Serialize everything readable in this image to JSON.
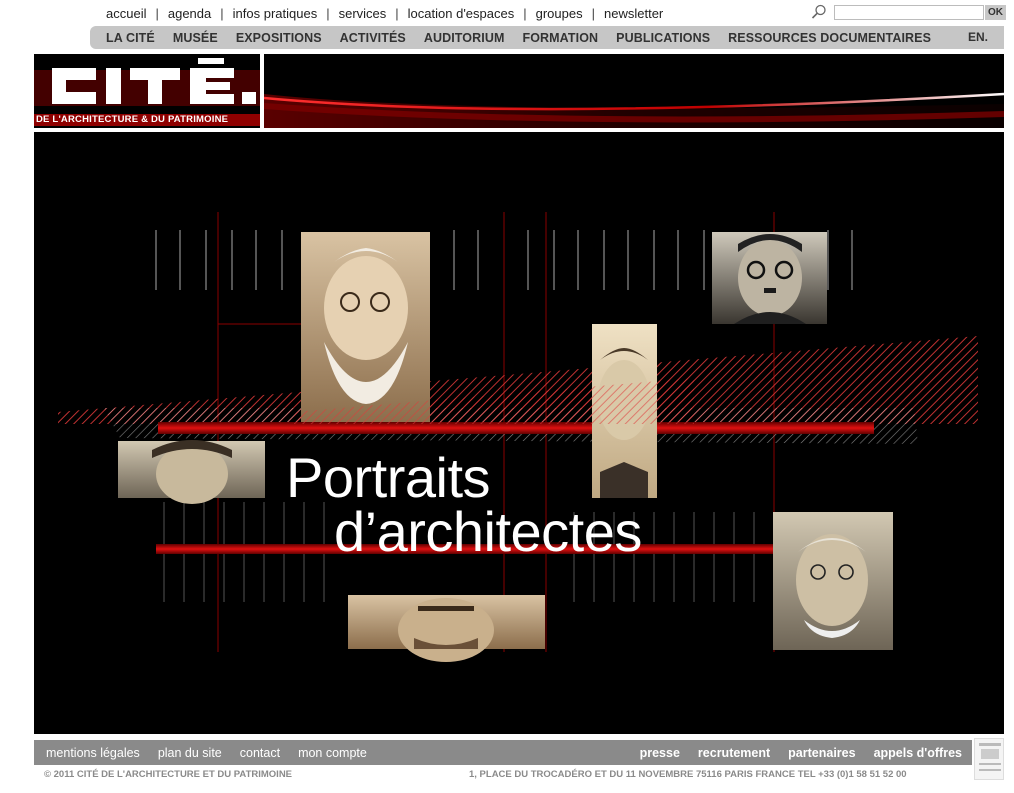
{
  "topnav": {
    "links": [
      "accueil",
      "agenda",
      "infos pratiques",
      "services",
      "location d'espaces",
      "groupes",
      "newsletter"
    ]
  },
  "search": {
    "value": "",
    "button_label": "OK"
  },
  "mainnav": {
    "items": [
      "LA CITÉ",
      "MUSÉE",
      "EXPOSITIONS",
      "ACTIVITÉS",
      "AUDITORIUM",
      "FORMATION",
      "PUBLICATIONS",
      "RESSOURCES DOCUMENTAIRES"
    ],
    "lang": "EN."
  },
  "logo": {
    "word": "CITÉ",
    "tagline": "DE L'ARCHITECTURE & DU PATRIMOINE"
  },
  "hero": {
    "title_line1": "Portraits",
    "title_line2": "d’architectes"
  },
  "footer": {
    "left_links": [
      "mentions légales",
      "plan du site",
      "contact",
      "mon compte"
    ],
    "right_links": [
      "presse",
      "recrutement",
      "partenaires",
      "appels d'offres"
    ],
    "copyright": "© 2011 CITÉ DE L'ARCHITECTURE ET DU PATRIMOINE",
    "address": "1, PLACE DU TROCADÉRO ET DU 11 NOVEMBRE   75116 PARIS FRANCE   TEL +33 (0)1 58 51 52 00"
  },
  "colors": {
    "brand_red": "#b00000",
    "nav_gray": "#c6c6c6",
    "footer_gray": "#8a8a8a"
  }
}
